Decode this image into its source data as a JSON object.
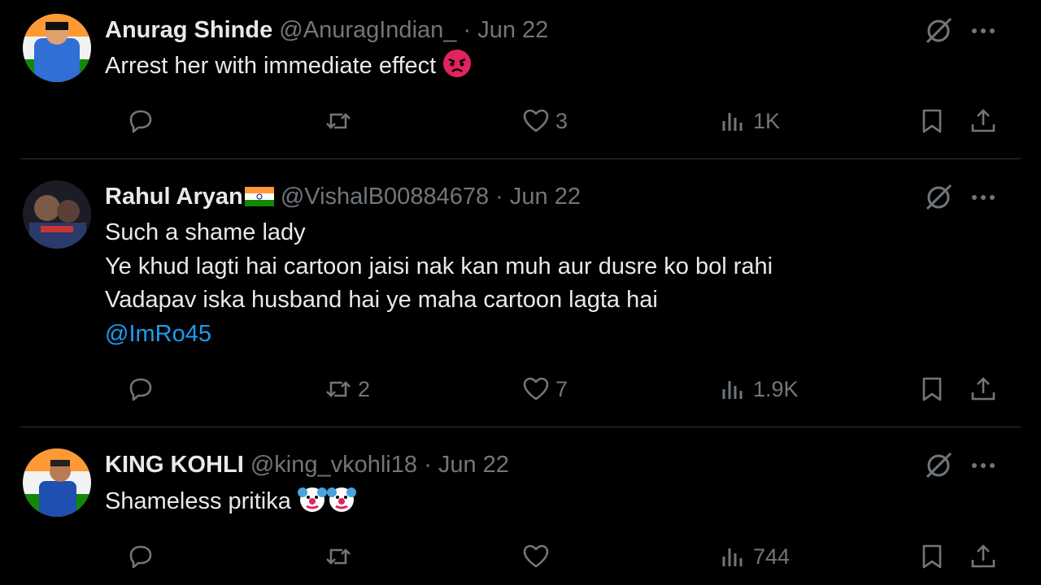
{
  "colors": {
    "background": "#000000",
    "text": "#e7e9ea",
    "muted": "#71767b",
    "link": "#1d9bf0",
    "divider": "#2f3336"
  },
  "tweets": [
    {
      "name": "Anurag Shinde",
      "handle": "@AnuragIndian_",
      "separator": "·",
      "date": "Jun 22",
      "lines": [
        "Arrest her with immediate effect"
      ],
      "emoji": "angry-face",
      "stats": {
        "replies": "",
        "reposts": "",
        "likes": "3",
        "views": "1K"
      }
    },
    {
      "name": "Rahul Aryan",
      "flag": "india-flag",
      "handle": "@VishalB00884678",
      "separator": "·",
      "date": "Jun 22",
      "lines": [
        "Such a shame lady",
        "Ye khud lagti hai cartoon jaisi nak kan muh aur dusre ko bol rahi",
        "Vadapav iska husband hai ye maha cartoon lagta hai"
      ],
      "mention": "@ImRo45",
      "stats": {
        "replies": "",
        "reposts": "2",
        "likes": "7",
        "views": "1.9K"
      }
    },
    {
      "name": "KING KOHLI",
      "handle": "@king_vkohli18",
      "separator": "·",
      "date": "Jun 22",
      "lines": [
        "Shameless pritika"
      ],
      "emoji": "clown-face",
      "stats": {
        "replies": "",
        "reposts": "",
        "likes": "",
        "views": "744"
      }
    }
  ],
  "icons": {
    "grok": "grok-icon",
    "more": "more-icon",
    "reply": "reply-icon",
    "repost": "repost-icon",
    "like": "like-icon",
    "views": "views-icon",
    "bookmark": "bookmark-icon",
    "share": "share-icon"
  }
}
